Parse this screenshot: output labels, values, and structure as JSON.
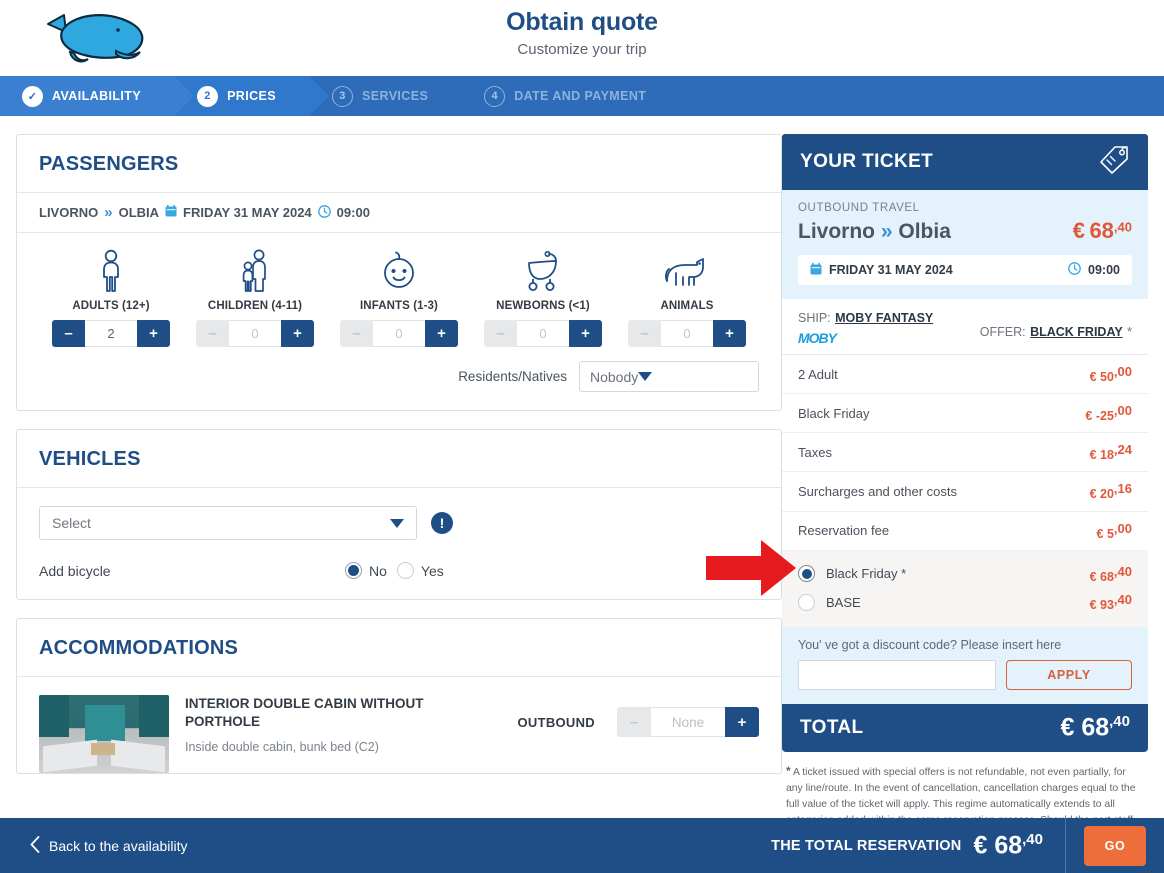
{
  "header": {
    "logo_icon": "whale-logo",
    "title": "Obtain quote",
    "subtitle": "Customize your trip"
  },
  "stepper": {
    "steps": [
      {
        "num": "✓",
        "label": "AVAILABILITY",
        "state": "done"
      },
      {
        "num": "2",
        "label": "PRICES",
        "state": "active"
      },
      {
        "num": "3",
        "label": "SERVICES",
        "state": "idle"
      },
      {
        "num": "4",
        "label": "DATE AND PAYMENT",
        "state": "idle"
      }
    ]
  },
  "passengers": {
    "title": "PASSENGERS",
    "route": {
      "from": "LIVORNO",
      "chevron": "»",
      "to": "OLBIA",
      "date": "FRIDAY 31 MAY 2024",
      "time": "09:00"
    },
    "types": [
      {
        "icon": "adult-icon",
        "label": "ADULTS (12+)",
        "value": "2",
        "minus_enabled": true
      },
      {
        "icon": "children-icon",
        "label": "CHILDREN (4-11)",
        "value": "0",
        "minus_enabled": false
      },
      {
        "icon": "infant-icon",
        "label": "INFANTS (1-3)",
        "value": "0",
        "minus_enabled": false
      },
      {
        "icon": "newborn-icon",
        "label": "NEWBORNS (<1)",
        "value": "0",
        "minus_enabled": false
      },
      {
        "icon": "animal-icon",
        "label": "ANIMALS",
        "value": "0",
        "minus_enabled": false
      }
    ],
    "residents_label": "Residents/Natives",
    "residents_value": "Nobody"
  },
  "vehicles": {
    "title": "VEHICLES",
    "select_value": "Select",
    "info_icon": "info-exclamation-icon",
    "bicycle_label": "Add bicycle",
    "bicycle_no": "No",
    "bicycle_yes": "Yes"
  },
  "accommodations": {
    "title": "ACCOMMODATIONS",
    "items": [
      {
        "thumb": "cabin-photo",
        "name": "INTERIOR DOUBLE CABIN WITHOUT PORTHOLE",
        "desc": "Inside double cabin, bunk bed (C2)",
        "direction": "OUTBOUND",
        "value": "None"
      }
    ]
  },
  "ticket": {
    "heading": "YOUR TICKET",
    "tag_icon": "price-tag-icon",
    "outbound_label": "OUTBOUND TRAVEL",
    "route_from": "Livorno",
    "route_chevron": "»",
    "route_to": "Olbia",
    "route_price_currency": "€",
    "route_price_main": "68",
    "route_price_cents": ",40",
    "date": "FRIDAY 31 MAY 2024",
    "time": "09:00",
    "ship_label": "SHIP:",
    "ship_name": "MOBY FANTASY",
    "ship_brand": "MOBY",
    "offer_label": "OFFER:",
    "offer_name": "BLACK FRIDAY",
    "offer_star": "*",
    "fees": [
      {
        "label": "2 Adult",
        "currency": "€",
        "amount": "50",
        "cents": ",00"
      },
      {
        "label": "Black Friday",
        "currency": "€",
        "amount": "-25",
        "cents": ",00"
      },
      {
        "label": "Taxes",
        "currency": "€",
        "amount": "18",
        "cents": ",24"
      },
      {
        "label": "Surcharges and other costs",
        "currency": "€",
        "amount": "20",
        "cents": ",16"
      },
      {
        "label": "Reservation fee",
        "currency": "€",
        "amount": "5",
        "cents": ",00"
      }
    ],
    "options": [
      {
        "name": "Black Friday *",
        "currency": "€",
        "amount": "68",
        "cents": ",40",
        "selected": true
      },
      {
        "name": "BASE",
        "currency": "€",
        "amount": "93",
        "cents": ",40",
        "selected": false
      }
    ],
    "discount_text": "You' ve got a discount code? Please insert here",
    "discount_value": "",
    "apply_label": "APPLY",
    "total_label": "TOTAL",
    "total_currency": "€",
    "total_amount": "68",
    "total_cents": ",40",
    "footnote_star": "*",
    "footnote": "A ticket issued with special offers is not refundable, not even partially, for any line/route. In the event of cancellation, cancellation charges equal to the full value of the ticket will apply. This regime automatically extends to all categories added within the same reservation process. Should the port staff find any discrepancies in the reservation in relation to the conditions present"
  },
  "annotation": {
    "arrow_icon": "red-arrow-pointer",
    "color": "#e5191e"
  },
  "bottom_bar": {
    "back_label": "Back to the availability",
    "back_icon": "chevron-left-icon",
    "total_label": "THE TOTAL RESERVATION",
    "total_currency": "€",
    "total_amount": "68",
    "total_cents": ",40",
    "go_label": "GO"
  },
  "colors": {
    "brand_blue": "#1f4e87",
    "accent_orange": "#e0573a",
    "go_orange": "#ee6e3b",
    "light_blue": "#e4f3fb"
  }
}
